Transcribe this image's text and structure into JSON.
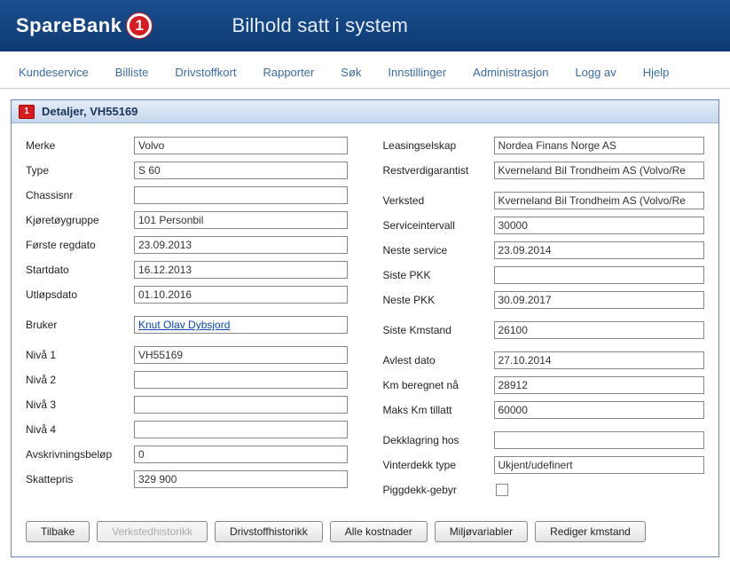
{
  "brand": {
    "text_prefix": "SpareBank",
    "logo_digit": "1"
  },
  "header": {
    "title": "Bilhold satt i system"
  },
  "nav": {
    "items": [
      "Kundeservice",
      "Billiste",
      "Drivstoffkort",
      "Rapporter",
      "Søk",
      "Innstillinger",
      "Administrasjon",
      "Logg av",
      "Hjelp"
    ]
  },
  "panel": {
    "title": "Detaljer, VH55169",
    "logo_digit": "1"
  },
  "left": {
    "merke_label": "Merke",
    "merke": "Volvo",
    "type_label": "Type",
    "type": "S 60",
    "chassisnr_label": "Chassisnr",
    "chassisnr": "",
    "kjoretoygruppe_label": "Kjøretøygruppe",
    "kjoretoygruppe": "101 Personbil",
    "forste_regdato_label": "Første regdato",
    "forste_regdato": "23.09.2013",
    "startdato_label": "Startdato",
    "startdato": "16.12.2013",
    "utlopsdato_label": "Utløpsdato",
    "utlopsdato": "01.10.2016",
    "bruker_label": "Bruker",
    "bruker": "Knut Olav Dybsjord",
    "niva1_label": "Nivå 1",
    "niva1": "VH55169",
    "niva2_label": "Nivå 2",
    "niva2": "",
    "niva3_label": "Nivå 3",
    "niva3": "",
    "niva4_label": "Nivå 4",
    "niva4": "",
    "avskrivningsbelop_label": "Avskrivningsbeløp",
    "avskrivningsbelop": "0",
    "skattepris_label": "Skattepris",
    "skattepris": "329 900"
  },
  "right": {
    "leasingselskap_label": "Leasingselskap",
    "leasingselskap": "Nordea Finans Norge AS",
    "restverdigarantist_label": "Restverdigarantist",
    "restverdigarantist": "Kverneland Bil Trondheim AS (Volvo/Re",
    "verksted_label": "Verksted",
    "verksted": "Kverneland Bil Trondheim AS (Volvo/Re",
    "serviceintervall_label": "Serviceintervall",
    "serviceintervall": "30000",
    "neste_service_label": "Neste service",
    "neste_service": "23.09.2014",
    "siste_pkk_label": "Siste PKK",
    "siste_pkk": "",
    "neste_pkk_label": "Neste PKK",
    "neste_pkk": "30.09.2017",
    "siste_kmstand_label": "Siste Kmstand",
    "siste_kmstand": "26100",
    "avlest_dato_label": "Avlest dato",
    "avlest_dato": "27.10.2014",
    "km_beregnet_na_label": "Km beregnet nå",
    "km_beregnet_na": "28912",
    "maks_km_tillatt_label": "Maks Km tillatt",
    "maks_km_tillatt": "60000",
    "dekklagring_hos_label": "Dekklagring hos",
    "dekklagring_hos": "",
    "vinterdekk_type_label": "Vinterdekk type",
    "vinterdekk_type": "Ukjent/udefinert",
    "piggdekk_gebyr_label": "Piggdekk-gebyr"
  },
  "buttons": {
    "tilbake": "Tilbake",
    "verkstedhistorikk": "Verkstedhistorikk",
    "drivstoffhistorikk": "Drivstoffhistorikk",
    "alle_kostnader": "Alle kostnader",
    "miljovariabler": "Miljøvariabler",
    "rediger_kmstand": "Rediger kmstand"
  }
}
